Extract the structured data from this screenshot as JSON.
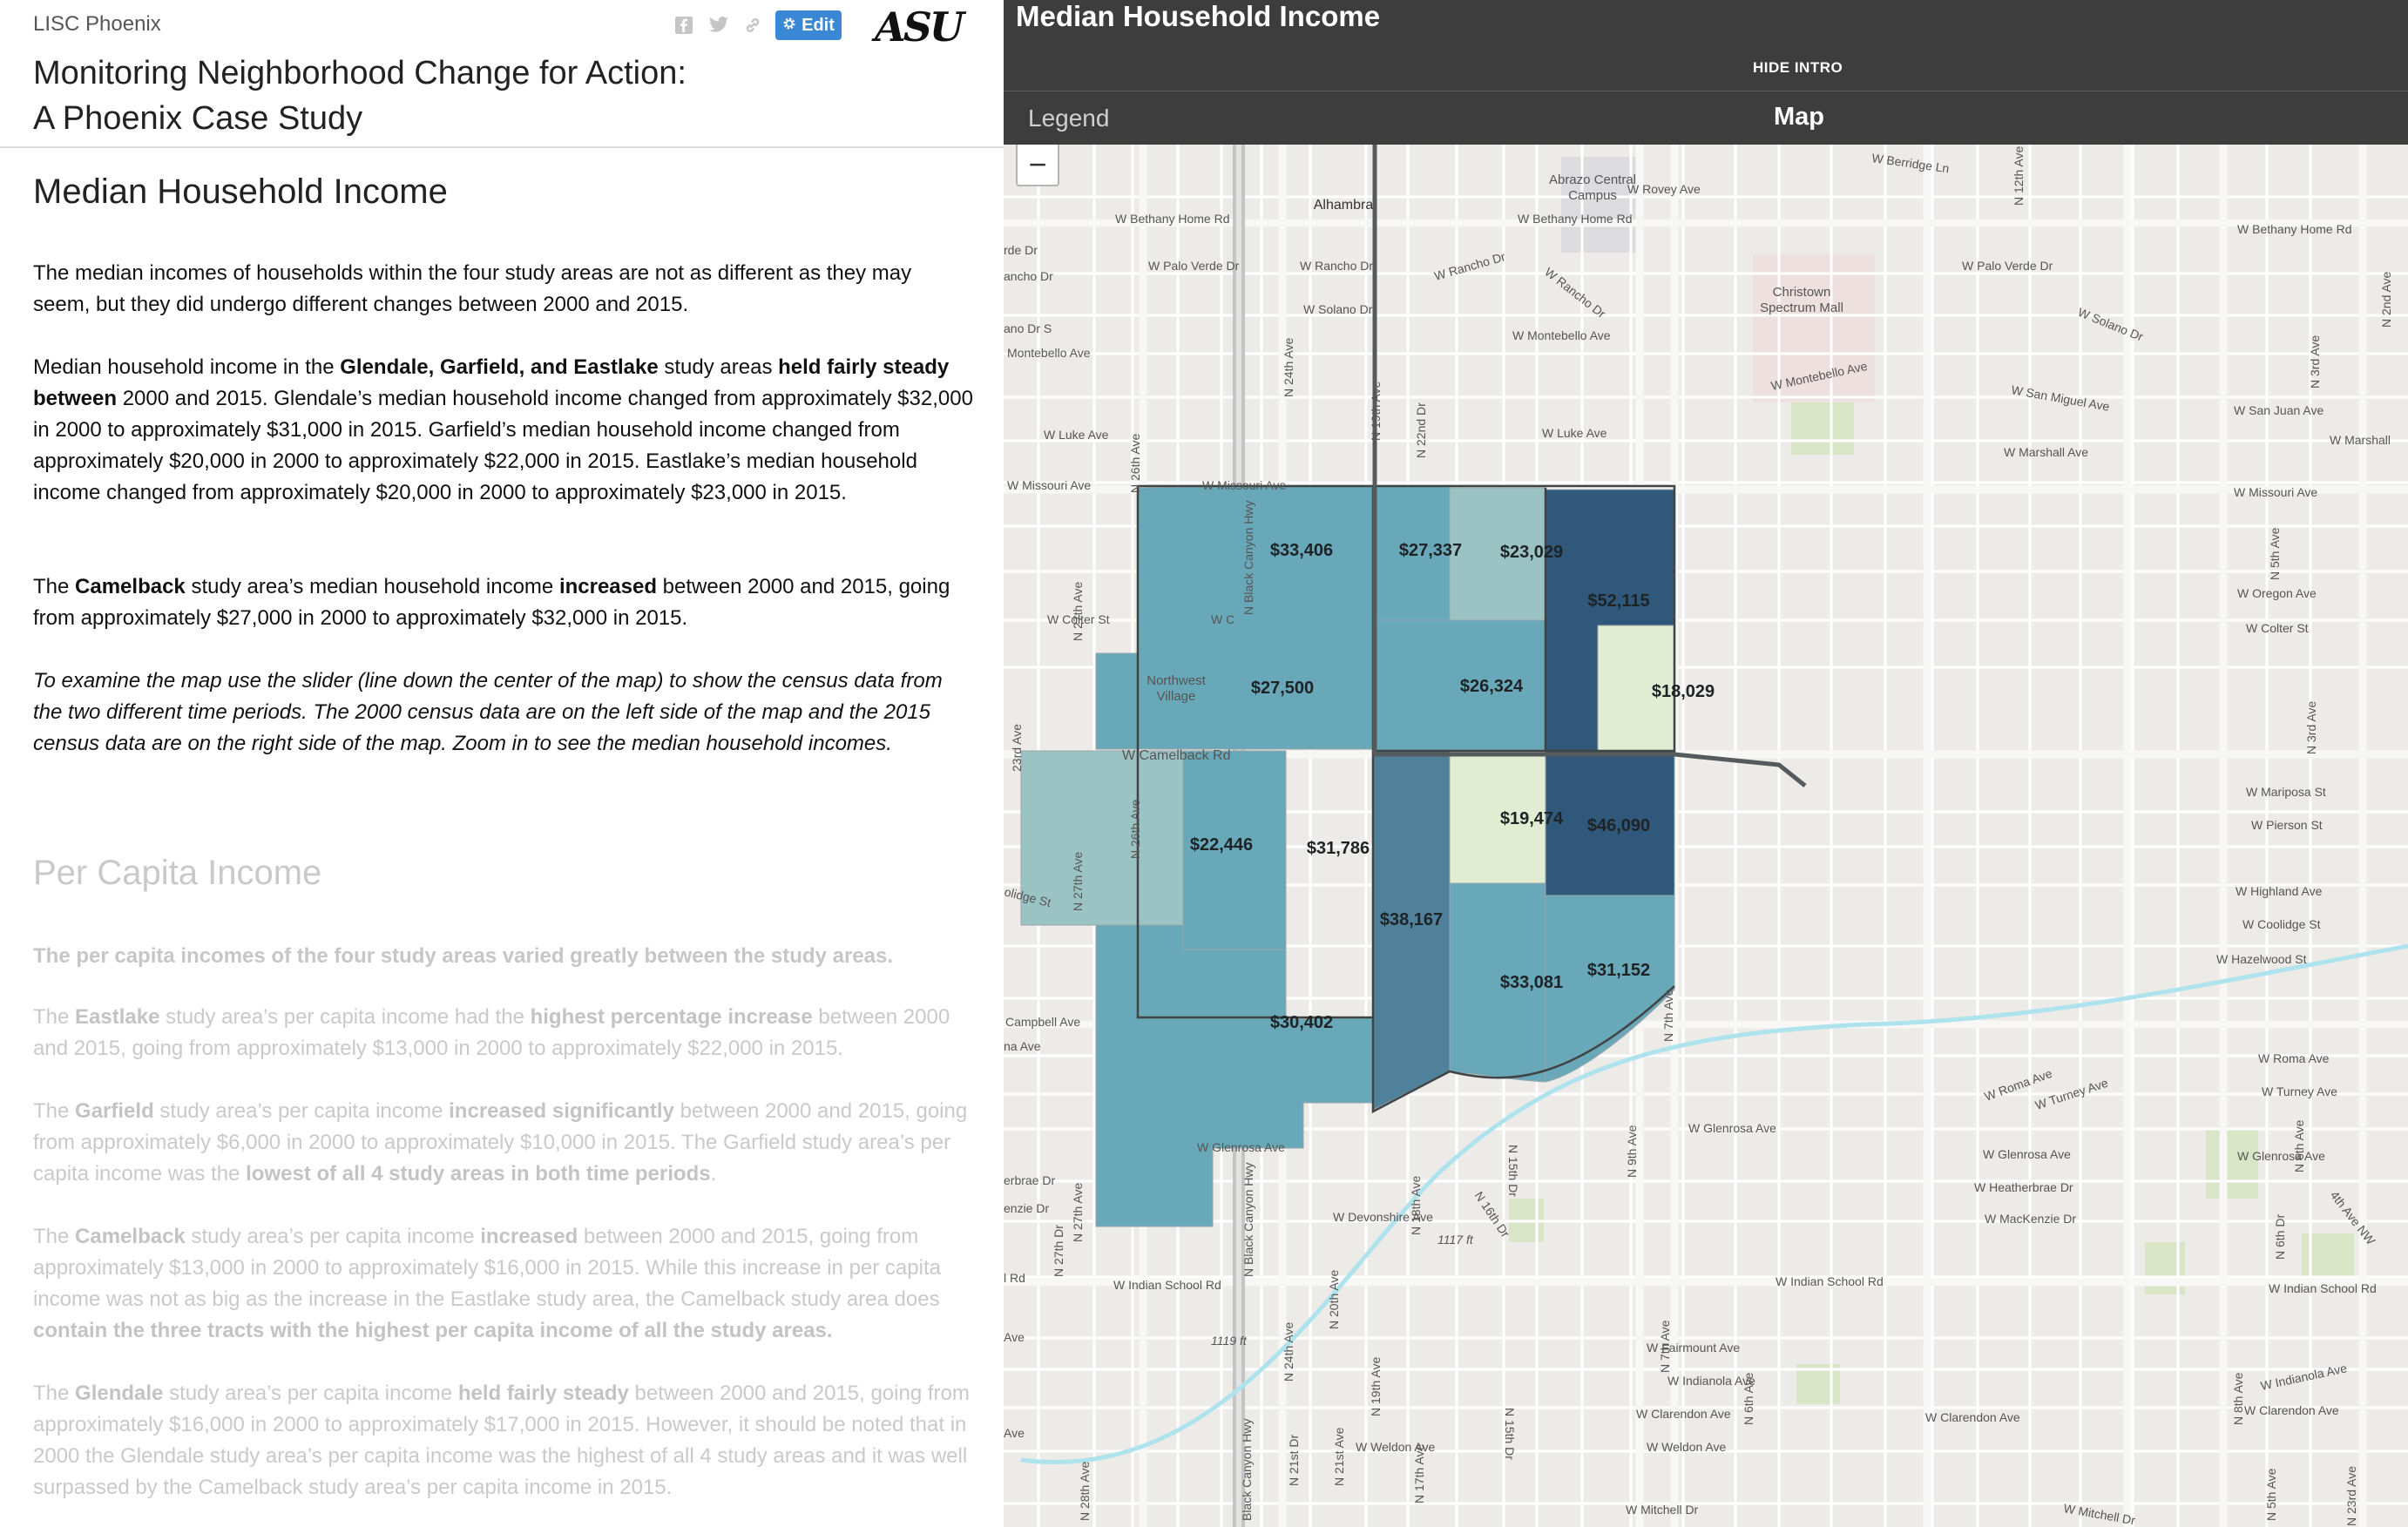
{
  "header": {
    "brand": "LISC Phoenix",
    "edit_label": "Edit",
    "logo_text": "ASU",
    "title_line1": "Monitoring Neighborhood Change for Action:",
    "title_line2": "A Phoenix Case Study"
  },
  "section1": {
    "heading": "Median Household Income",
    "p1": "The median incomes of households within the four study areas are not as different as they may seem, but they did undergo different changes between 2000 and 2015.",
    "p2": [
      {
        "t": "Median household income in the ",
        "b": false
      },
      {
        "t": "Glendale, Garfield, and Eastlake",
        "b": true
      },
      {
        "t": " study areas ",
        "b": false
      },
      {
        "t": "held fairly steady between",
        "b": true
      },
      {
        "t": " 2000 and 2015. Glendale’s median household income changed from approximately $32,000 in 2000 to approximately $31,000 in 2015. Garfield’s median household income changed from approximately $20,000 in 2000 to approximately $22,000 in 2015. Eastlake’s median household income changed from approximately $20,000 in 2000 to approximately $23,000 in 2015.",
        "b": false
      }
    ],
    "p3": [
      {
        "t": "The ",
        "b": false
      },
      {
        "t": "Camelback",
        "b": true
      },
      {
        "t": " study area’s median household income ",
        "b": false
      },
      {
        "t": "increased",
        "b": true
      },
      {
        "t": " between 2000 and 2015, going from approximately $27,000 in 2000 to approximately $32,000 in 2015.",
        "b": false
      }
    ],
    "p4": "To examine the map use the slider (line down the center of the map) to show the census data from the two different time periods. The 2000 census data are on the left side of the map and the 2015 census data are on the right side of the map. Zoom in to see the median household incomes."
  },
  "section2": {
    "heading": "Per Capita Income",
    "p1": "The per capita incomes of the four study areas varied greatly between the study areas.",
    "p2": [
      {
        "t": "The ",
        "b": false
      },
      {
        "t": "Eastlake",
        "b": true
      },
      {
        "t": " study area’s per capita income had the ",
        "b": false
      },
      {
        "t": "highest percentage increase",
        "b": true
      },
      {
        "t": " between 2000 and 2015, going from approximately $13,000 in 2000 to approximately $22,000 in 2015.",
        "b": false
      }
    ],
    "p3": [
      {
        "t": "The ",
        "b": false
      },
      {
        "t": "Garfield",
        "b": true
      },
      {
        "t": " study area’s per capita income ",
        "b": false
      },
      {
        "t": "increased significantly",
        "b": true
      },
      {
        "t": " between 2000 and 2015, going from approximately $6,000 in 2000 to approximately $10,000 in 2015. The Garfield study area’s per capita income was the ",
        "b": false
      },
      {
        "t": "lowest of all 4 study areas in both time periods",
        "b": true
      },
      {
        "t": ".",
        "b": false
      }
    ],
    "p4": [
      {
        "t": "The ",
        "b": false
      },
      {
        "t": "Camelback",
        "b": true
      },
      {
        "t": " study area’s per capita income ",
        "b": false
      },
      {
        "t": "increased",
        "b": true
      },
      {
        "t": " between 2000 and 2015, going from approximately $13,000 in 2000 to approximately $16,000 in 2015. While this increase in per capita income was not as big as the increase in the Eastlake study area, the Camelback study area does ",
        "b": false
      },
      {
        "t": "contain the three tracts with the highest per capita income of all the study areas.",
        "b": true
      }
    ],
    "p5": [
      {
        "t": "The ",
        "b": false
      },
      {
        "t": "Glendale",
        "b": true
      },
      {
        "t": " study area’s per capita income ",
        "b": false
      },
      {
        "t": "held fairly steady",
        "b": true
      },
      {
        "t": " between 2000 and 2015, going from approximately $16,000 in 2000 to approximately $17,000 in 2015. However, it should be noted that in 2000 the Glendale study area’s per capita income was the highest of all 4 study areas and it was well surpassed by the Camelback study area’s per capita income in 2015.",
        "b": false
      }
    ]
  },
  "map_panel": {
    "title": "Median Household Income",
    "hide_intro": "HIDE INTRO",
    "tab_legend": "Legend",
    "tab_map": "Map",
    "zoom_out": "−"
  },
  "colors": {
    "very_light": "#e2ecd2",
    "light": "#9cc3c3",
    "mid": "#68a8b8",
    "dark": "#4f819b",
    "darkest": "#30587a"
  },
  "tract_values": {
    "t1": "$33,406",
    "t2": "$27,337",
    "t3": "$23,029",
    "t4": "$52,115",
    "t5": "$27,500",
    "t6": "$26,324",
    "t7": "$18,029",
    "t8": "$22,446",
    "t9": "$31,786",
    "t10": "$19,474",
    "t11": "$46,090",
    "t12": "$38,167",
    "t13": "$33,081",
    "t14": "$31,152",
    "t15": "$30,402"
  },
  "map_labels": {
    "alhambra": "Alhambra",
    "abrazo1": "Abrazo Central",
    "abrazo2": "Campus",
    "christown1": "Christown",
    "christown2": "Spectrum Mall",
    "northwest1": "Northwest",
    "northwest2": "Village",
    "berridge": "W Berridge Ln",
    "rovey": "W Rovey Ave",
    "bethany1": "W Bethany Home Rd",
    "bethany2": "W Bethany Home Rd",
    "bethany3": "W Bethany Home Rd",
    "palo1": "W Palo Verde Dr",
    "palo2": "W Palo Verde Dr",
    "rancho1": "W Rancho Dr",
    "rancho2": "W Rancho Dr",
    "rancho3": "W Rancho Dr",
    "solano1": "W Solano Dr",
    "solano2": "W Solano Dr",
    "montebello1": "W Montebello Ave",
    "montebello2": "W Montebello Ave",
    "montebello3": "Montebello Ave",
    "sanmiguel": "W San Miguel Ave",
    "sanjuan": "W San Juan Ave",
    "luke1": "W Luke Ave",
    "luke2": "W Luke Ave",
    "marshall1": "W Marshall Ave",
    "marshall2": "W Marshall",
    "missouri1": "W Missouri Ave",
    "missouri2": "W Missouri Ave",
    "missouri3": "W Missouri Ave",
    "oregon": "W Oregon Ave",
    "colter1": "W Colter St",
    "colter2": "W Colter St",
    "colter3": "W C",
    "camelback": "W Camelback Rd",
    "mariposa": "W Mariposa St",
    "pierson": "W Pierson St",
    "highland": "W Highland Ave",
    "coolidge1": "W Coolidge St",
    "coolidge2": "olidge St",
    "hazelwood": "W Hazelwood St",
    "campbell": "Campbell Ave",
    "roma1": "W Roma Ave",
    "roma2": "W Roma Ave",
    "turney1": "W Turney Ave",
    "turney2": "W Turney Ave",
    "glenrosa1": "W Glenrosa Ave",
    "glenrosa2": "W Glenrosa Ave",
    "glenrosa3": "W Glenrosa Ave",
    "glenrosa4": "W Glenrosa Ave",
    "heatherbrae1": "W Heatherbrae Dr",
    "heatherbrae2": "erbrae Dr",
    "mackenzie1": "W MacKenzie Dr",
    "mackenzie2": "enzie Dr",
    "devonshire": "W Devonshire Ave",
    "elev1": "1117 ft",
    "elev2": "1119 ft",
    "indianschool1": "W Indian School Rd",
    "indianschool2": "W Indian School Rd",
    "indianschool3": "W Indian School Rd",
    "fairmount": "W Fairmount Ave",
    "indianola1": "W Indianola Ave",
    "indianola2": "W Indianola Ave",
    "clarendon1": "W Clarendon Ave",
    "clarendon2": "W Clarendon Ave",
    "clarendon3": "W Clarendon Ave",
    "weldon1": "W Weldon Ave",
    "weldon2": "W Weldon Ave",
    "mitchell1": "W Mitchell Dr",
    "mitchell2": "W Mitchell Dr",
    "ave_edge1": "rde Dr",
    "ave_edge2": "ancho Dr",
    "ave_edge3": "ano Dr S",
    "ave_edge4": "na Ave",
    "ave_edge5": "l Rd",
    "ave_edge6": "Ave",
    "ave_edge7": "Ave",
    "n12th": "N 12th Ave",
    "n3rd1": "N 3rd Ave",
    "n3rd2": "N 3rd Ave",
    "n2nd": "N 2nd Ave",
    "n5th1": "N 5th Ave",
    "n5th2": "N 5th Ave",
    "n24th1": "N 24th Ave",
    "n24th2": "N 24th Ave",
    "n26th1": "N 26th Ave",
    "n26th2": "N 26th Ave",
    "n27th1": "N 27th Ave",
    "n27th2": "N 27th Ave",
    "n27th3": "N 27th Ave",
    "n28th": "N 28th Ave",
    "n22nd": "N 22nd Dr",
    "n19th1": "N 19th Ave",
    "n19th2": "N 19th Ave",
    "n27thdr": "N 27th Dr",
    "n20th": "N 20th Ave",
    "n18th": "N 18th Ave",
    "n16th": "N 16th Dr",
    "n15th1": "N 15th Dr",
    "n15th2": "N 15th Dr",
    "n21stdr": "N 21st Dr",
    "n21st": "N 21st Ave",
    "n17th": "N 17th Ave",
    "n9th": "N 9th Ave",
    "n7th1": "N 7th Ave",
    "n7th2": "N 7th Ave",
    "n6thdr": "N 6th Dr",
    "n6th": "N 6th Ave",
    "n4th": "4th Ave NW",
    "n8th": "N 8th Ave",
    "n23rd": "N 23rd Ave",
    "n23rd_edge": "23rd Ave",
    "bc1": "N Black Canyon Hwy",
    "bc2": "N Black Canyon Hwy",
    "bc3": "Black Canyon Hwy"
  }
}
